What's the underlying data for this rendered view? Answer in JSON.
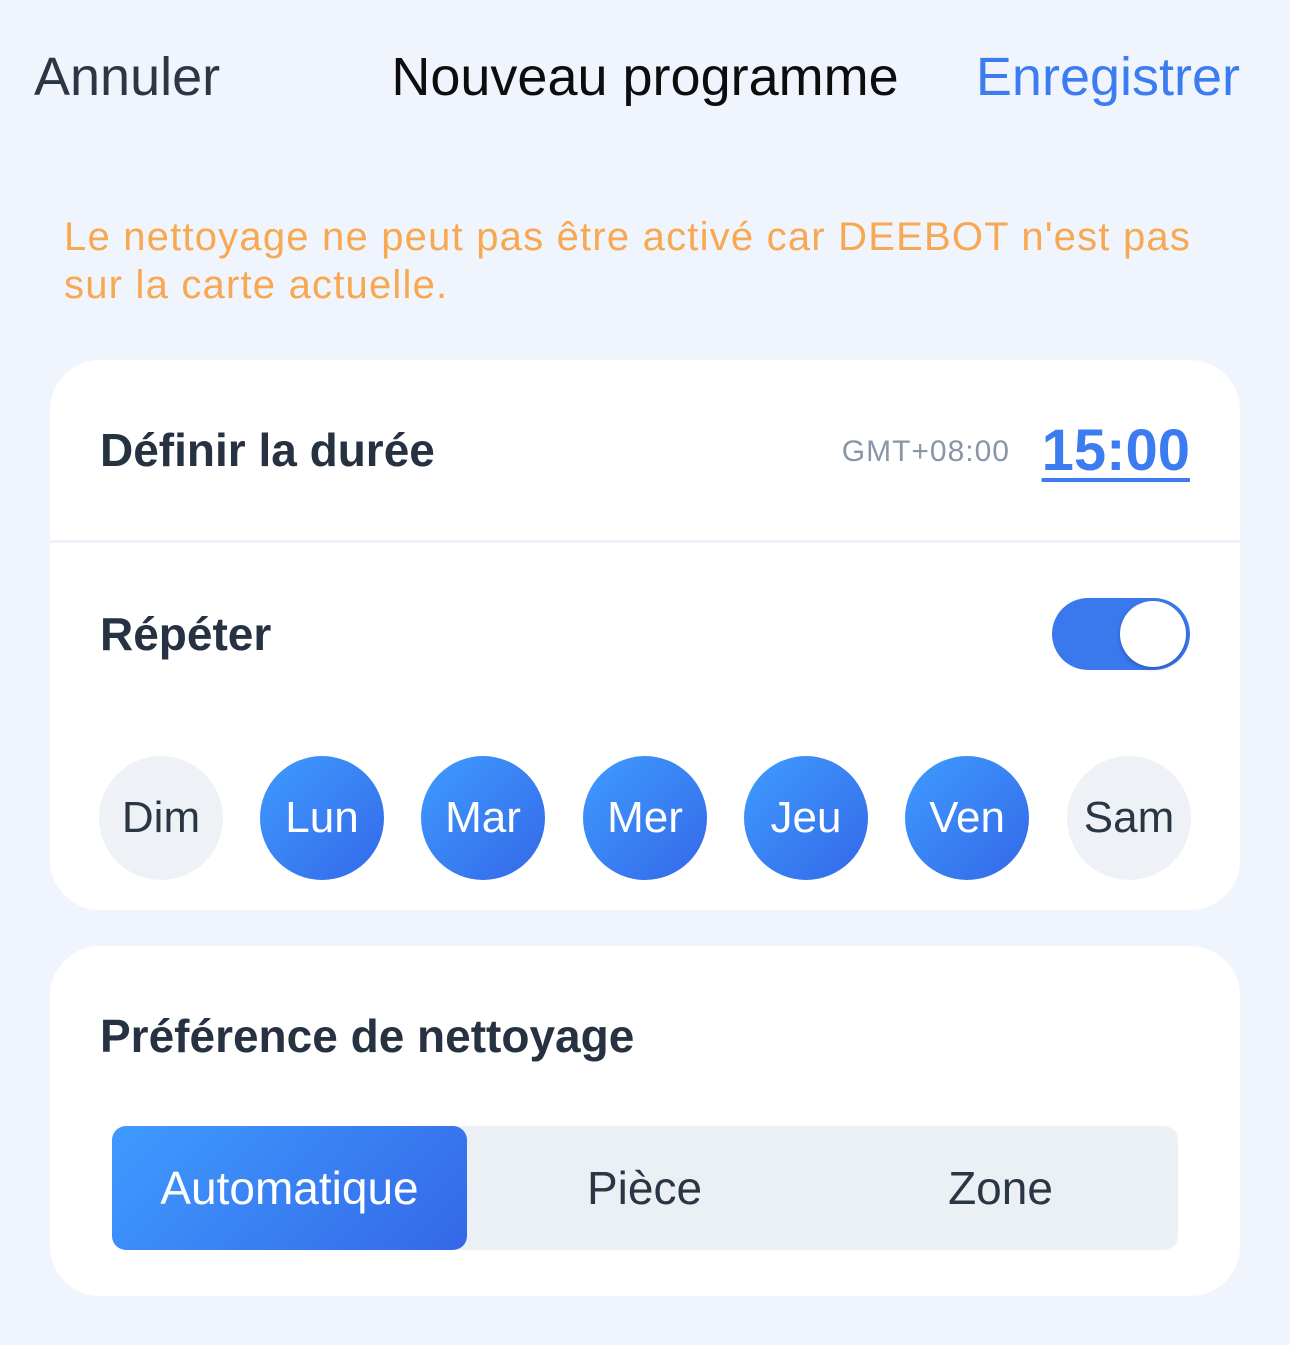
{
  "nav": {
    "cancel_label": "Annuler",
    "title": "Nouveau programme",
    "save_label": "Enregistrer"
  },
  "warning": "Le nettoyage ne peut pas être activé car DEEBOT n'est pas sur la carte actuelle.",
  "schedule": {
    "duration_label": "Définir la durée",
    "timezone": "GMT+08:00",
    "time": "15:00",
    "repeat_label": "Répéter",
    "repeat_enabled": true,
    "days": [
      {
        "label": "Dim",
        "selected": false
      },
      {
        "label": "Lun",
        "selected": true
      },
      {
        "label": "Mar",
        "selected": true
      },
      {
        "label": "Mer",
        "selected": true
      },
      {
        "label": "Jeu",
        "selected": true
      },
      {
        "label": "Ven",
        "selected": true
      },
      {
        "label": "Sam",
        "selected": false
      }
    ]
  },
  "preference": {
    "label": "Préférence de nettoyage",
    "options": [
      "Automatique",
      "Pièce",
      "Zone"
    ],
    "selected": "Automatique"
  },
  "colors": {
    "accent": "#3b7df0",
    "warning": "#f7a850",
    "background": "#f0f5fd"
  }
}
